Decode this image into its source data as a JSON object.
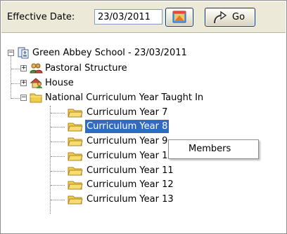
{
  "toolbar": {
    "effective_date_label": "Effective Date:",
    "effective_date_value": "23/03/2011",
    "go_label": "Go",
    "icons": {
      "calendar": "calendar-icon",
      "go": "go-arrow-icon"
    }
  },
  "tree": {
    "root": {
      "label": "Green Abbey School - 23/03/2011",
      "icon": "school-icon",
      "expanded": true
    },
    "nodes": [
      {
        "label": "Pastoral Structure",
        "icon": "people-group-icon",
        "expanded": false
      },
      {
        "label": "House",
        "icon": "house-group-icon",
        "expanded": false
      },
      {
        "label": "National Curriculum Year Taught In",
        "icon": "folder-open-icon",
        "expanded": true,
        "children": [
          {
            "label": "Curriculum Year  7",
            "icon": "folder-icon"
          },
          {
            "label": "Curriculum Year  8",
            "icon": "folder-icon",
            "selected": true
          },
          {
            "label": "Curriculum Year  9",
            "icon": "folder-icon"
          },
          {
            "label": "Curriculum Year 10",
            "icon": "folder-icon"
          },
          {
            "label": "Curriculum Year 11",
            "icon": "folder-icon"
          },
          {
            "label": "Curriculum Year 12",
            "icon": "folder-icon"
          },
          {
            "label": "Curriculum Year 13",
            "icon": "folder-icon"
          }
        ]
      }
    ]
  },
  "context_menu": {
    "items": [
      "Members"
    ]
  },
  "colors": {
    "selection": "#316ac5",
    "toolbar": "#ece9d8",
    "folder": "#f2cd4a"
  }
}
